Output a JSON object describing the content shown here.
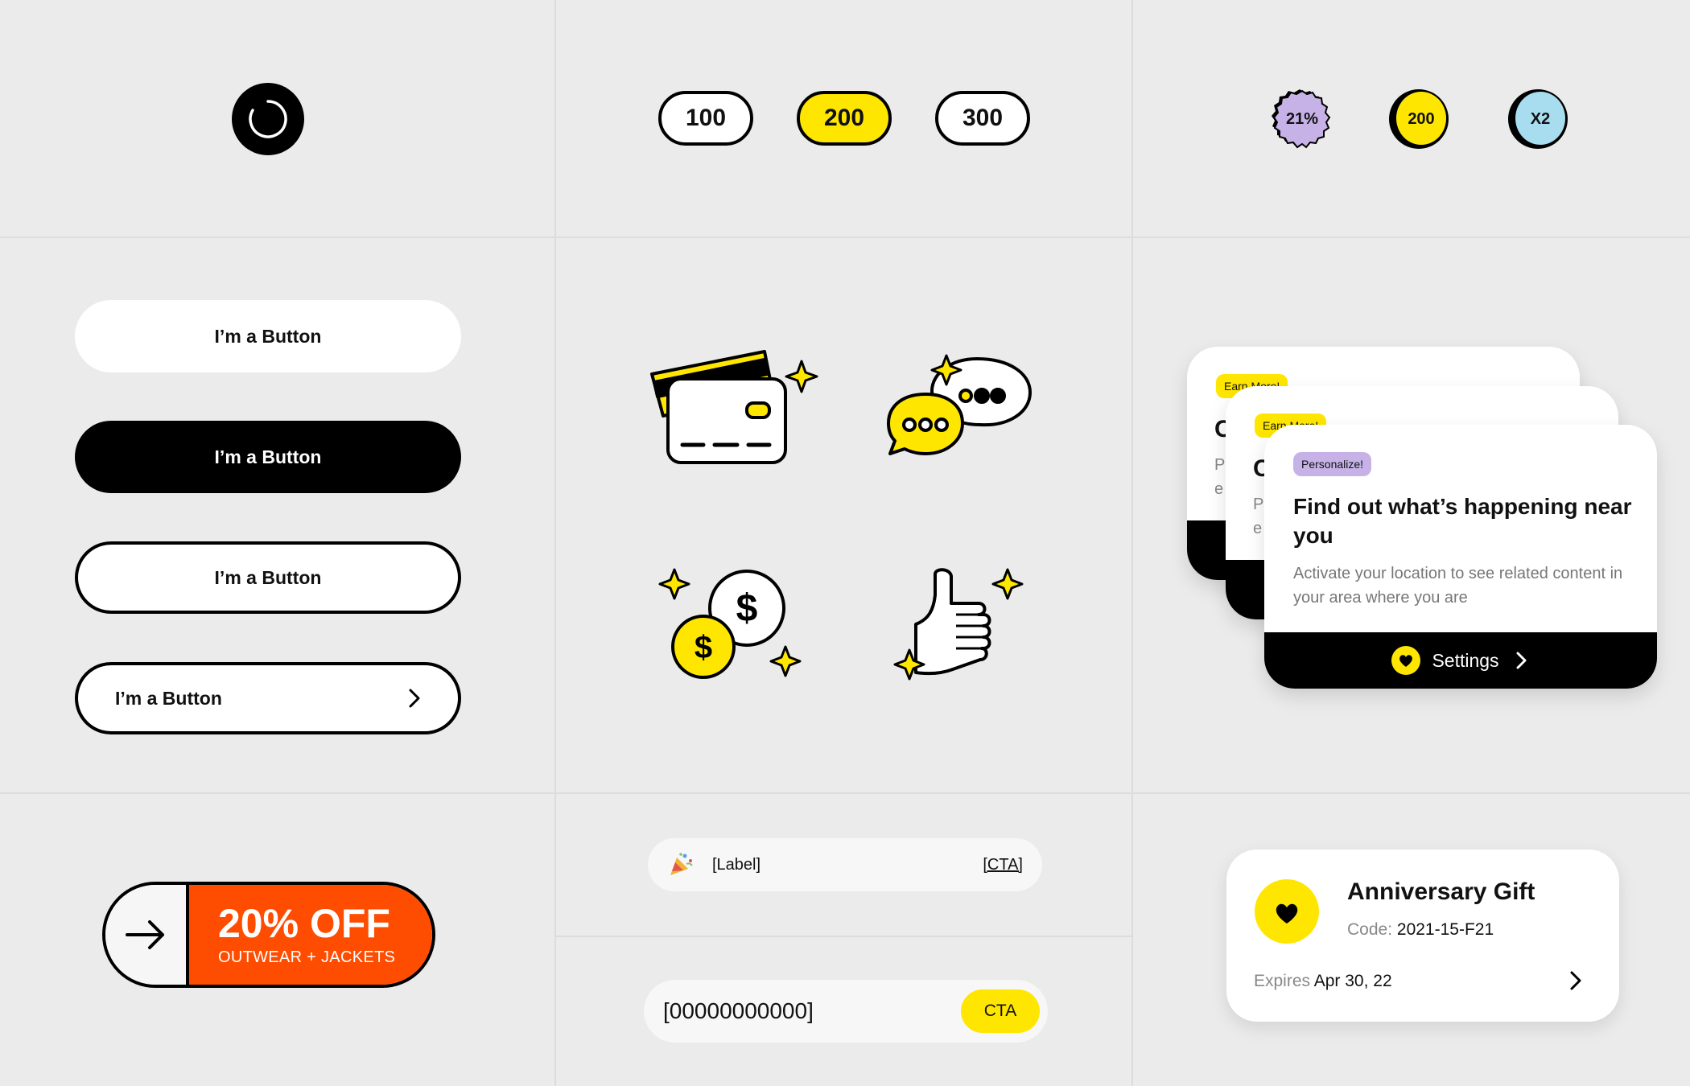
{
  "row1": {
    "counters": [
      {
        "label": "100",
        "selected": false
      },
      {
        "label": "200",
        "selected": true
      },
      {
        "label": "300",
        "selected": false
      }
    ],
    "badges": [
      {
        "label": "21%",
        "color": "#c7b2e8"
      },
      {
        "label": "200",
        "color": "#ffe600"
      },
      {
        "label": "X2",
        "color": "#a8dcef"
      }
    ]
  },
  "buttons": {
    "white": "I’m a Button",
    "black": "I’m a Button",
    "outline": "I’m a Button",
    "outline_arrow": "I’m a Button"
  },
  "illustrations": [
    "credit-cards",
    "chat-bubbles",
    "coins",
    "thumbs-up"
  ],
  "cards": {
    "back1": {
      "tag": "Earn More!",
      "title_start": "C",
      "body_start": "P",
      "body_start2": "e"
    },
    "back2": {
      "tag": "Earn More!",
      "title_start": "C",
      "body_start": "P",
      "body_start2": "e"
    },
    "front": {
      "tag": "Personalize!",
      "title": "Find out what’s happening near you",
      "body": "Activate your location to see related content in your area where you are",
      "action": "Settings"
    }
  },
  "promo": {
    "title": "20% OFF",
    "subtitle": "OUTWEAR + JACKETS",
    "color": "#ff4d00"
  },
  "toast": {
    "label": "[Label]",
    "cta": "[CTA]"
  },
  "code_input": {
    "value": "[00000000000]",
    "cta": "CTA"
  },
  "gift": {
    "title": "Anniversary Gift",
    "code_label": "Code:",
    "code": "2021-15-F21",
    "expires_label": "Expires",
    "expires": "Apr 30, 22"
  },
  "colors": {
    "accent": "#ffe600",
    "promo": "#ff4d00",
    "lavender": "#c7b2e8",
    "sky": "#a8dcef"
  }
}
